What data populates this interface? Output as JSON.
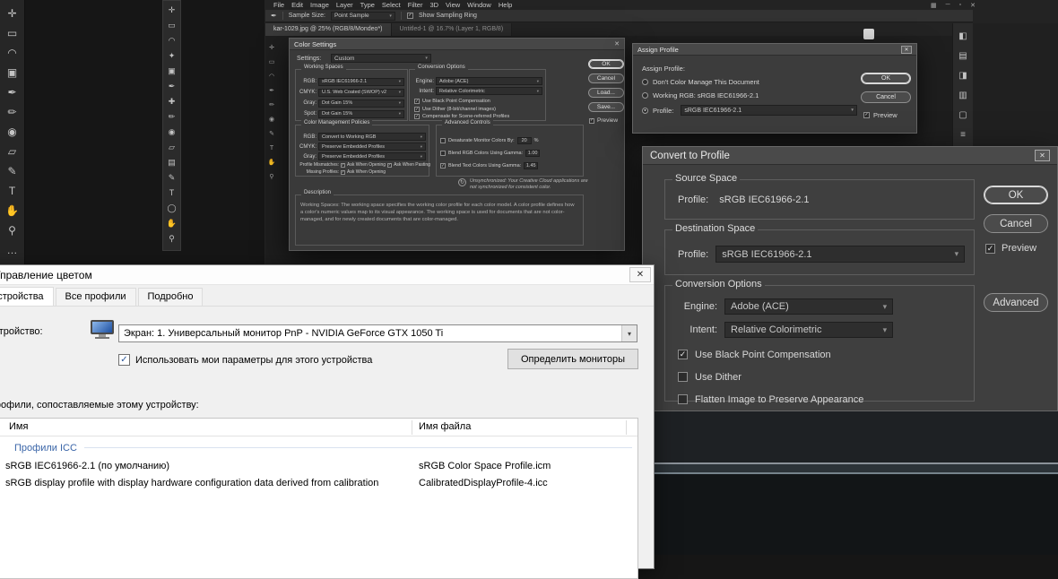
{
  "colors": {
    "app_bg": "#161616",
    "ps_window_bg": "#232323",
    "ps_dialog_bg": "#3a3a3a",
    "cp_dialog_bg": "#3f3f3f",
    "win_dialog_bg": "#f0f0f0",
    "group_label_blue": "#3a65a8",
    "check_blue": "#2b579a"
  },
  "ps": {
    "menu": [
      "File",
      "Edit",
      "Image",
      "Layer",
      "Type",
      "Select",
      "Filter",
      "3D",
      "View",
      "Window",
      "Help"
    ],
    "options_bar": {
      "tool_icon": "✒",
      "sample_label": "Sample Size:",
      "sample_value": "Point Sample",
      "ring_label": "Show Sampling Ring"
    },
    "doc_tabs": [
      "kar-1029.jpg @ 25% (RGB/8/Mondeo*)",
      "Untitled-1 @ 16.7% (Layer 1, RGB/8)"
    ],
    "tools_main": [
      {
        "name": "move-tool",
        "glyph": "✛"
      },
      {
        "name": "marquee-tool",
        "glyph": "▭"
      },
      {
        "name": "lasso-tool",
        "glyph": "◠"
      },
      {
        "name": "crop-tool",
        "glyph": "▣"
      },
      {
        "name": "eyedropper-tool",
        "glyph": "✒"
      },
      {
        "name": "brush-tool",
        "glyph": "✏"
      },
      {
        "name": "clone-stamp-tool",
        "glyph": "◉"
      },
      {
        "name": "eraser-tool",
        "glyph": "▱"
      },
      {
        "name": "pen-tool",
        "glyph": "✎"
      },
      {
        "name": "type-tool",
        "glyph": "T"
      },
      {
        "name": "hand-tool",
        "glyph": "✋"
      },
      {
        "name": "zoom-tool",
        "glyph": "⚲"
      },
      {
        "name": "more-tools",
        "glyph": "…"
      }
    ],
    "tools_secondary": [
      {
        "name": "move-tool",
        "glyph": "✛"
      },
      {
        "name": "marquee-tool",
        "glyph": "▭"
      },
      {
        "name": "lasso-tool",
        "glyph": "◠"
      },
      {
        "name": "magic-wand-tool",
        "glyph": "✦"
      },
      {
        "name": "crop-tool",
        "glyph": "▣"
      },
      {
        "name": "eyedropper-tool",
        "glyph": "✒"
      },
      {
        "name": "healing-tool",
        "glyph": "✚"
      },
      {
        "name": "brush-tool",
        "glyph": "✏"
      },
      {
        "name": "clone-stamp-tool",
        "glyph": "◉"
      },
      {
        "name": "eraser-tool",
        "glyph": "▱"
      },
      {
        "name": "gradient-tool",
        "glyph": "▤"
      },
      {
        "name": "pen-tool",
        "glyph": "✎"
      },
      {
        "name": "type-tool",
        "glyph": "T"
      },
      {
        "name": "shape-tool",
        "glyph": "◯"
      },
      {
        "name": "hand-tool",
        "glyph": "✋"
      },
      {
        "name": "zoom-tool",
        "glyph": "⚲"
      }
    ],
    "tools_window": [
      {
        "name": "move-tool",
        "glyph": "✛"
      },
      {
        "name": "marquee-tool",
        "glyph": "▭"
      },
      {
        "name": "lasso-tool",
        "glyph": "◠"
      },
      {
        "name": "eyedropper-tool",
        "glyph": "✒"
      },
      {
        "name": "brush-tool",
        "glyph": "✏"
      },
      {
        "name": "clone-stamp-tool",
        "glyph": "◉"
      },
      {
        "name": "pen-tool",
        "glyph": "✎"
      },
      {
        "name": "type-tool",
        "glyph": "T"
      },
      {
        "name": "hand-tool",
        "glyph": "✋"
      },
      {
        "name": "zoom-tool",
        "glyph": "⚲"
      }
    ],
    "window_icons": [
      {
        "name": "workspace-switcher-icon",
        "glyph": "▦"
      },
      {
        "name": "minimize-icon",
        "glyph": "─"
      },
      {
        "name": "restore-icon",
        "glyph": "▫"
      },
      {
        "name": "close-icon",
        "glyph": "✕"
      }
    ],
    "dock_icons": [
      {
        "name": "color-panel-icon",
        "glyph": "◧"
      },
      {
        "name": "swatches-panel-icon",
        "glyph": "▤"
      },
      {
        "name": "adjustments-panel-icon",
        "glyph": "◨"
      },
      {
        "name": "layers-panel-icon",
        "glyph": "▥"
      },
      {
        "name": "channels-panel-icon",
        "glyph": "▢"
      },
      {
        "name": "properties-panel-icon",
        "glyph": "≡"
      }
    ]
  },
  "cs": {
    "title": "Color Settings",
    "settings_label": "Settings:",
    "settings_value": "Custom",
    "ws": {
      "legend": "Working Spaces",
      "rows": [
        {
          "label": "RGB:",
          "value": "sRGB IEC61966-2.1"
        },
        {
          "label": "CMYK:",
          "value": "U.S. Web Coated (SWOP) v2"
        },
        {
          "label": "Gray:",
          "value": "Dot Gain 15%"
        },
        {
          "label": "Spot:",
          "value": "Dot Gain 15%"
        }
      ]
    },
    "conv": {
      "legend": "Conversion Options",
      "engine_label": "Engine:",
      "engine_value": "Adobe (ACE)",
      "intent_label": "Intent:",
      "intent_value": "Relative Colorimetric",
      "checks": [
        {
          "mark": "✓",
          "label": "Use Black Point Compensation"
        },
        {
          "mark": "✓",
          "label": "Use Dither (8-bit/channel images)"
        },
        {
          "mark": "✓",
          "label": "Compensate for Scene-referred Profiles"
        }
      ]
    },
    "pol": {
      "legend": "Color Management Policies",
      "rows": [
        {
          "label": "RGB:",
          "value": "Convert to Working RGB"
        },
        {
          "label": "CMYK:",
          "value": "Preserve Embedded Profiles"
        },
        {
          "label": "Gray:",
          "value": "Preserve Embedded Profiles"
        }
      ],
      "mismatch_label": "Profile Mismatches:",
      "mm1_mark": "✓",
      "mm1_label": "Ask When Opening",
      "mm2_mark": "✓",
      "mm2_label": "Ask When Pasting",
      "missing_label": "Missing Profiles:",
      "mp1_mark": "✓",
      "mp1_label": "Ask When Opening"
    },
    "adv": {
      "legend": "Advanced Controls",
      "rows": [
        {
          "mark": "",
          "label": "Desaturate Monitor Colors By:",
          "value": "20",
          "suffix": "%"
        },
        {
          "mark": "",
          "label": "Blend RGB Colors Using Gamma:",
          "value": "1.00",
          "suffix": ""
        },
        {
          "mark": "✓",
          "label": "Blend Text Colors Using Gamma:",
          "value": "1.45",
          "suffix": ""
        }
      ]
    },
    "sync_note": "Unsynchronized: Your Creative Cloud applications are not synchronized for consistent color.",
    "desc": {
      "legend": "Description",
      "text": "Working Spaces: The working space specifies the working color profile for each color model. A color profile defines how a color's numeric values map to its visual appearance. The working space is used for documents that are not color-managed, and for newly created documents that are color-managed."
    },
    "buttons": {
      "ok": "OK",
      "cancel": "Cancel",
      "load": "Load...",
      "save": "Save...",
      "preview": "Preview",
      "preview_mark": "✓"
    }
  },
  "ap": {
    "title": "Assign Profile",
    "heading": "Assign Profile:",
    "opt1": {
      "mark": "",
      "label": "Don't Color Manage This Document"
    },
    "opt2": {
      "mark": "",
      "label": "Working RGB:  sRGB IEC61966-2.1"
    },
    "opt3": {
      "mark": "●",
      "label": "Profile:",
      "value": "sRGB IEC61966-2.1"
    },
    "buttons": {
      "ok": "OK",
      "cancel": "Cancel",
      "preview": "Preview",
      "preview_mark": "✓"
    }
  },
  "cp": {
    "title": "Convert to Profile",
    "src": {
      "legend": "Source Space",
      "profile_label": "Profile:",
      "profile_value": "sRGB IEC61966-2.1"
    },
    "dst": {
      "legend": "Destination Space",
      "profile_label": "Profile:",
      "profile_value": "sRGB IEC61966-2.1"
    },
    "conv": {
      "legend": "Conversion Options",
      "engine_label": "Engine:",
      "engine_value": "Adobe (ACE)",
      "intent_label": "Intent:",
      "intent_value": "Relative Colorimetric"
    },
    "checks": [
      {
        "mark": "✓",
        "label": "Use Black Point Compensation"
      },
      {
        "mark": "",
        "label": "Use Dither"
      },
      {
        "mark": "",
        "label": "Flatten Image to Preserve Appearance"
      }
    ],
    "buttons": {
      "ok": "OK",
      "cancel": "Cancel",
      "preview": "Preview",
      "preview_mark": "✓",
      "advanced": "Advanced"
    }
  },
  "wc": {
    "title": "Управление цветом",
    "tab1": "Устройства",
    "tab2": "Все профили",
    "tab3": "Подробно",
    "device_label": "Устройство:",
    "device_value": "Экран: 1. Универсальный монитор PnP - NVIDIA GeForce GTX 1050 Ti",
    "use_mark": "✓",
    "use_my_settings": "Использовать мои параметры для этого устройства",
    "identify_button": "Определить мониторы",
    "profiles_label": "Профили, сопоставляемые этому устройству:",
    "col_name": "Имя",
    "col_file": "Имя файла",
    "group": "Профили ICC",
    "rows": [
      {
        "name": "sRGB IEC61966-2.1 (по умолчанию)",
        "file": "sRGB Color Space Profile.icm"
      },
      {
        "name": "sRGB display profile with display hardware configuration data derived from calibration",
        "file": "CalibratedDisplayProfile-4.icc"
      }
    ]
  }
}
